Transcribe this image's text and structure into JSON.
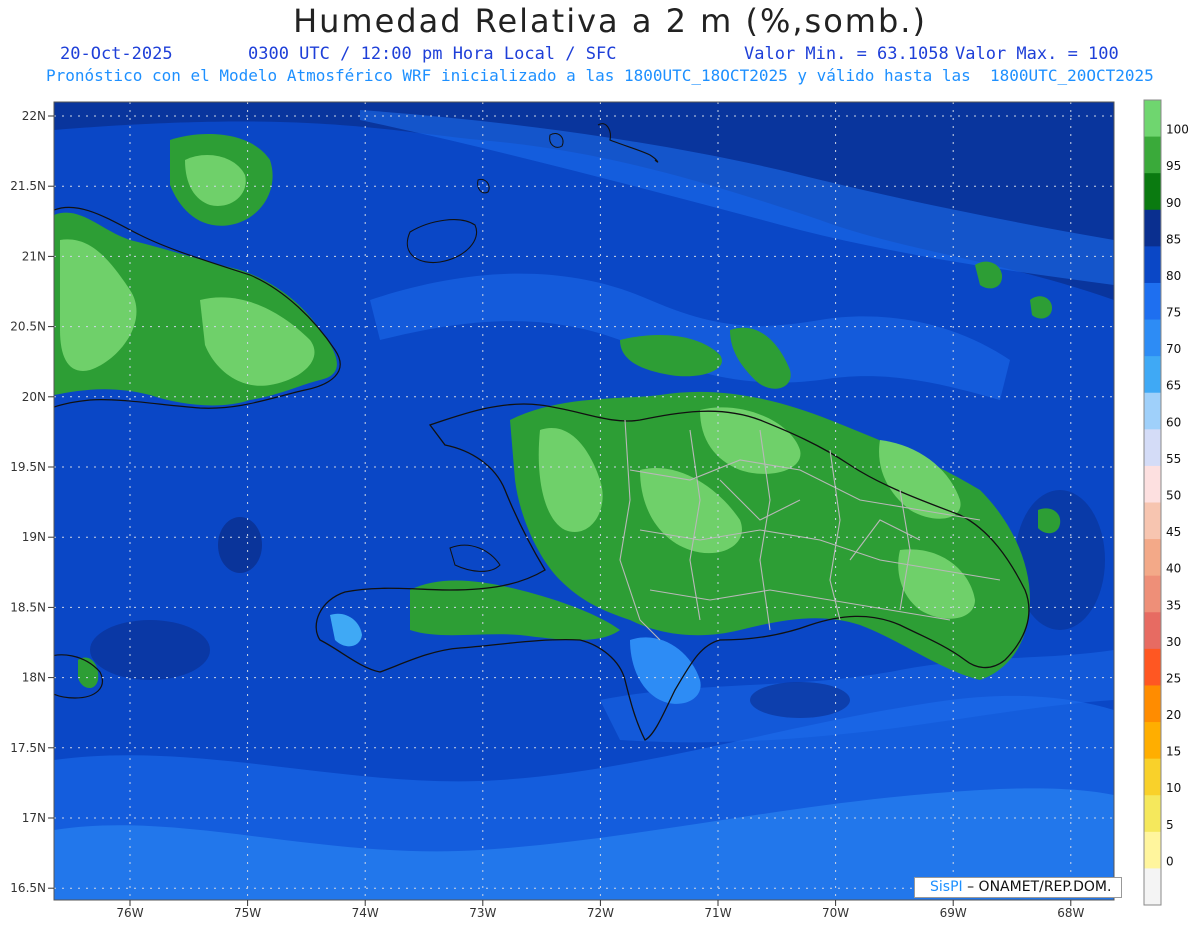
{
  "header": {
    "title": "Humedad Relativa a 2 m (%,somb.)",
    "date": "20-Oct-2025",
    "time_info": "0300 UTC / 12:00 pm Hora Local / SFC",
    "min_label": "Valor Min. = 63.1058",
    "max_label": "Valor Max. = 100",
    "forecast": "Pronóstico con el Modelo Atmosférico WRF inicializado a las 1800UTC_18OCT2025 y válido hasta las  1800UTC_20OCT2025"
  },
  "map": {
    "lat_labels": [
      "22N",
      "21.5N",
      "21N",
      "20.5N",
      "20N",
      "19.5N",
      "19N",
      "18.5N",
      "18N",
      "17.5N",
      "17N",
      "16.5N"
    ],
    "lon_labels": [
      "76W",
      "75W",
      "74W",
      "73W",
      "72W",
      "71W",
      "70W",
      "69W",
      "68W"
    ],
    "colors": {
      "ocean_base": "#0a47c6",
      "ocean_dark": "#0a2f8f",
      "ocean_light": "#1e6ff0",
      "ocean_lighter": "#2d8cf5",
      "green_dark": "#0a7a10",
      "green_mid": "#2d9e35",
      "green_light": "#6fd06a",
      "coast": "#111111",
      "provinces": "#b8b8b8"
    }
  },
  "colorbar": {
    "labels": [
      "100",
      "95",
      "90",
      "85",
      "80",
      "75",
      "70",
      "65",
      "60",
      "55",
      "50",
      "45",
      "40",
      "35",
      "30",
      "25",
      "20",
      "15",
      "10",
      "5",
      "0"
    ],
    "colors": [
      "#6fd66f",
      "#3aaa3a",
      "#0a7a10",
      "#0a2f8f",
      "#0a47c6",
      "#1e6ff0",
      "#2d8cf5",
      "#3fa9f5",
      "#9fd0fa",
      "#d4dcf7",
      "#fde0e0",
      "#f7c5b0",
      "#f3a988",
      "#ee8f78",
      "#e76b62",
      "#ff5722",
      "#ff8c00",
      "#ffae00",
      "#f9d12a",
      "#f5e85c",
      "#fff59d",
      "#f4f4f4"
    ]
  },
  "credit": {
    "brand": "SisPI",
    "text": " – ONAMET/REP.DOM."
  }
}
